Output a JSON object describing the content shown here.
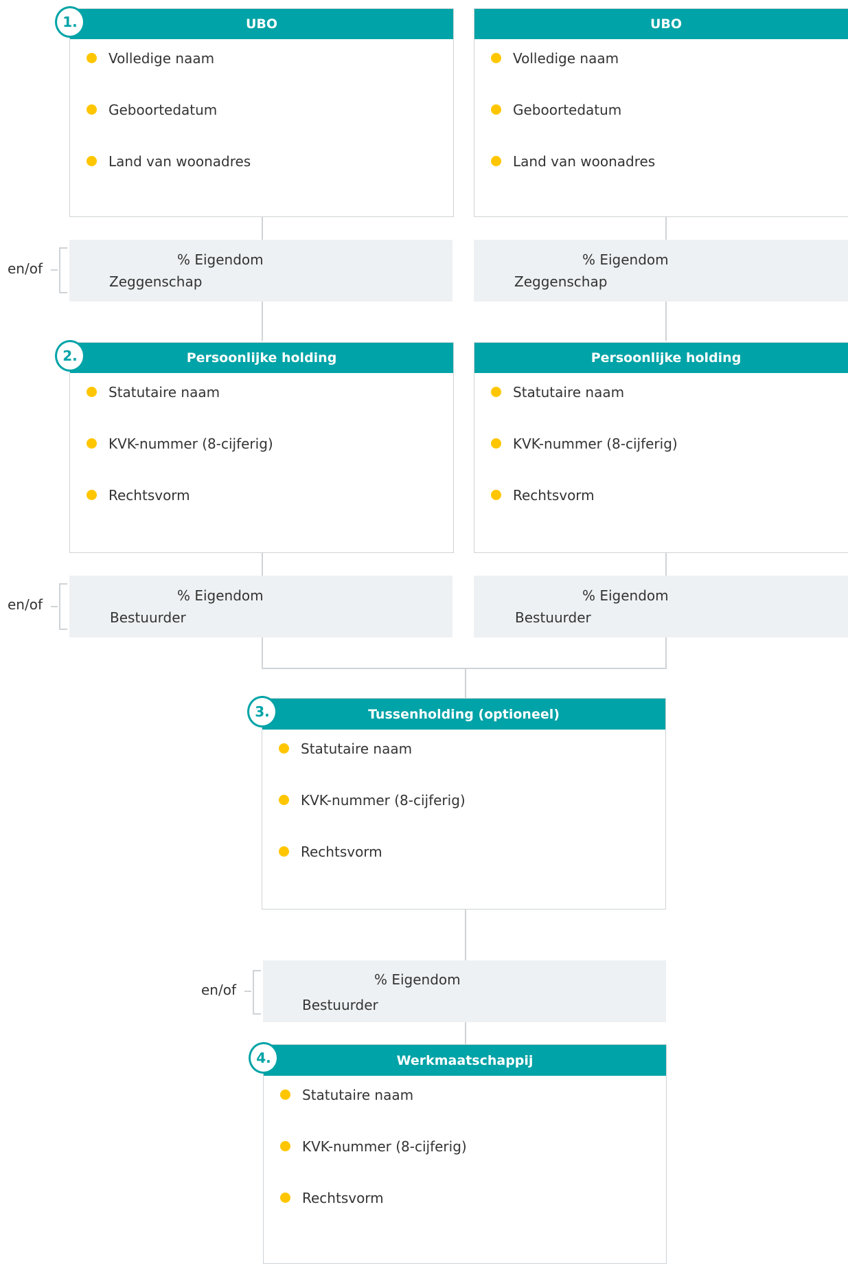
{
  "levels": [
    {
      "number": "1.",
      "boxes": [
        {
          "title": "UBO",
          "items": [
            "Volledige naam",
            "Geboortedatum",
            "Land van woonadres"
          ]
        },
        {
          "title": "UBO",
          "items": [
            "Volledige naam",
            "Geboortedatum",
            "Land van woonadres"
          ]
        }
      ],
      "relations": [
        {
          "line1": "% Eigendom",
          "line2": "Zeggenschap"
        },
        {
          "line1": "% Eigendom",
          "line2": "Zeggenschap"
        }
      ],
      "connector_label": "en/of"
    },
    {
      "number": "2.",
      "boxes": [
        {
          "title": "Persoonlijke holding",
          "items": [
            "Statutaire naam",
            "KVK-nummer (8-cijferig)",
            "Rechtsvorm"
          ]
        },
        {
          "title": "Persoonlijke holding",
          "items": [
            "Statutaire naam",
            "KVK-nummer (8-cijferig)",
            "Rechtsvorm"
          ]
        }
      ],
      "relations": [
        {
          "line1": "% Eigendom",
          "line2": "Bestuurder"
        },
        {
          "line1": "% Eigendom",
          "line2": "Bestuurder"
        }
      ],
      "connector_label": "en/of"
    },
    {
      "number": "3.",
      "boxes": [
        {
          "title": "Tussenholding (optioneel)",
          "items": [
            "Statutaire naam",
            "KVK-nummer (8-cijferig)",
            "Rechtsvorm"
          ]
        }
      ],
      "relations": [
        {
          "line1": "% Eigendom",
          "line2": "Bestuurder"
        }
      ],
      "connector_label": "en/of"
    },
    {
      "number": "4.",
      "boxes": [
        {
          "title": "Werkmaatschappij",
          "items": [
            "Statutaire naam",
            "KVK-nummer (8-cijferig)",
            "Rechtsvorm"
          ]
        }
      ]
    }
  ],
  "colors": {
    "header": "#00a3a7",
    "bullet": "#ffc600",
    "relation_bg": "#eef1f3",
    "line": "#cfd3d6"
  }
}
